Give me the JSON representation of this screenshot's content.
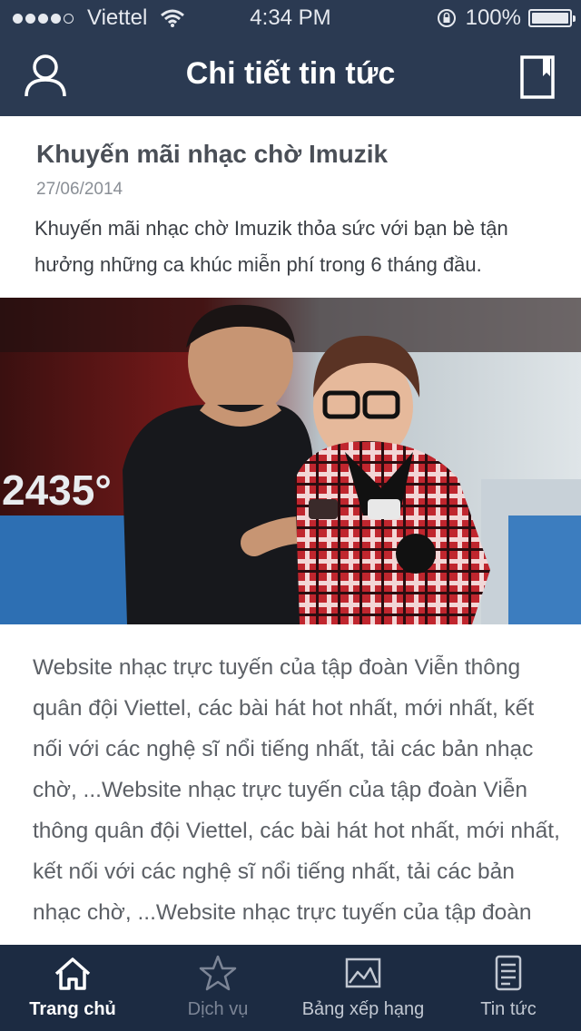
{
  "status_bar": {
    "carrier": "Viettel",
    "time": "4:34 PM",
    "battery": "100%",
    "battery_level": 1.0,
    "signal_bars_filled": 4,
    "signal_bars_total": 5
  },
  "nav": {
    "title": "Chi tiết tin tức",
    "left_icon": "user-icon",
    "right_icon": "bookmark-icon"
  },
  "article": {
    "title": "Khuyến mãi nhạc chờ Imuzik",
    "date": "27/06/2014",
    "summary": "Khuyến mãi nhạc chờ Imuzik thỏa sức với bạn bè tận hưởng những ca khúc miễn phí trong 6 tháng đầu.",
    "image_text": "2435°",
    "body": "Website nhạc trực tuyến của tập đoàn Viễn thông quân đội Viettel, các bài hát hot nhất, mới nhất, kết nối với các nghệ sĩ nổi tiếng nhất, tải các bản nhạc chờ, ...Website nhạc trực tuyến của tập đoàn Viễn thông quân đội Viettel, các bài hát hot nhất, mới nhất, kết nối với các nghệ sĩ nổi tiếng nhất, tải các bản nhạc chờ, ...Website nhạc trực tuyến của tập đoàn"
  },
  "tabs": [
    {
      "label": "Trang chủ",
      "icon": "home-icon",
      "state": "active"
    },
    {
      "label": "Dịch vụ",
      "icon": "star-icon",
      "state": "disabled"
    },
    {
      "label": "Bảng xếp hạng",
      "icon": "chart-icon",
      "state": "normal"
    },
    {
      "label": "Tin tức",
      "icon": "news-icon",
      "state": "normal"
    }
  ],
  "colors": {
    "header_bg": "#2b3a52",
    "tabbar_bg": "#1c2b42"
  }
}
